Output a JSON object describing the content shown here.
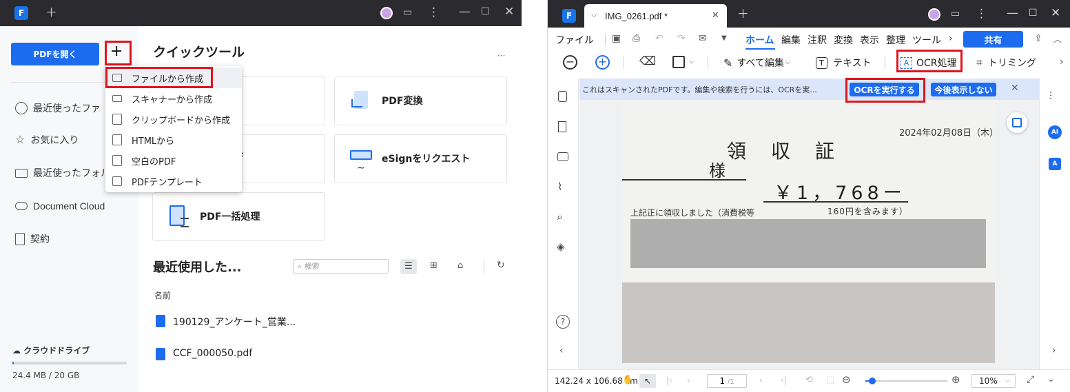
{
  "left": {
    "open_pdf": "PDFを開く",
    "plus": "+",
    "quick_tools_title": "クイックツール",
    "more": "···",
    "nav": [
      "最近使ったファ",
      "お気に入り",
      "最近使ったフォル",
      "Document Cloud",
      "契約"
    ],
    "cloud_title": "クラウドドライブ",
    "storage": "24.4 MB / 20 GB",
    "storage_fraction": 0.0012,
    "tools": [
      "PDF変換",
      "eSignをリクエスト",
      "PDF一括処理"
    ],
    "card_partial": "F",
    "menu": [
      "ファイルから作成",
      "スキャナーから作成",
      "クリップボードから作成",
      "HTMLから",
      "空白のPDF",
      "PDFテンプレート"
    ],
    "recent_title": "最近使用した...",
    "search_placeholder": "検索",
    "column_name": "名前",
    "files": [
      "190129_アンケート_営業...",
      "CCF_000050.pdf"
    ]
  },
  "right": {
    "tab_title": "IMG_0261.pdf *",
    "menus": [
      "ファイル",
      "ホーム",
      "編集",
      "注釈",
      "変換",
      "表示",
      "整理",
      "ツール"
    ],
    "share": "共有",
    "tools": [
      "すべて編集",
      "テキスト",
      "OCR処理",
      "トリミング"
    ],
    "banner_text": "これはスキャンされたPDFです。編集や検索を行うには、OCRを実...",
    "run_ocr": "OCRを実行する",
    "dont_show": "今後表示しない",
    "receipt_date": "2024年02月08日（木）",
    "receipt_title": "領　収　証",
    "receipt_to": "様",
    "receipt_amount": "￥1，768ー",
    "receipt_note": "上記正に領収しました（消費税等",
    "receipt_tax": "160円を含みます）",
    "page_size": "142.24 x 106.68 cm",
    "page_current": "1",
    "page_total": "/1",
    "zoom": "10%"
  }
}
